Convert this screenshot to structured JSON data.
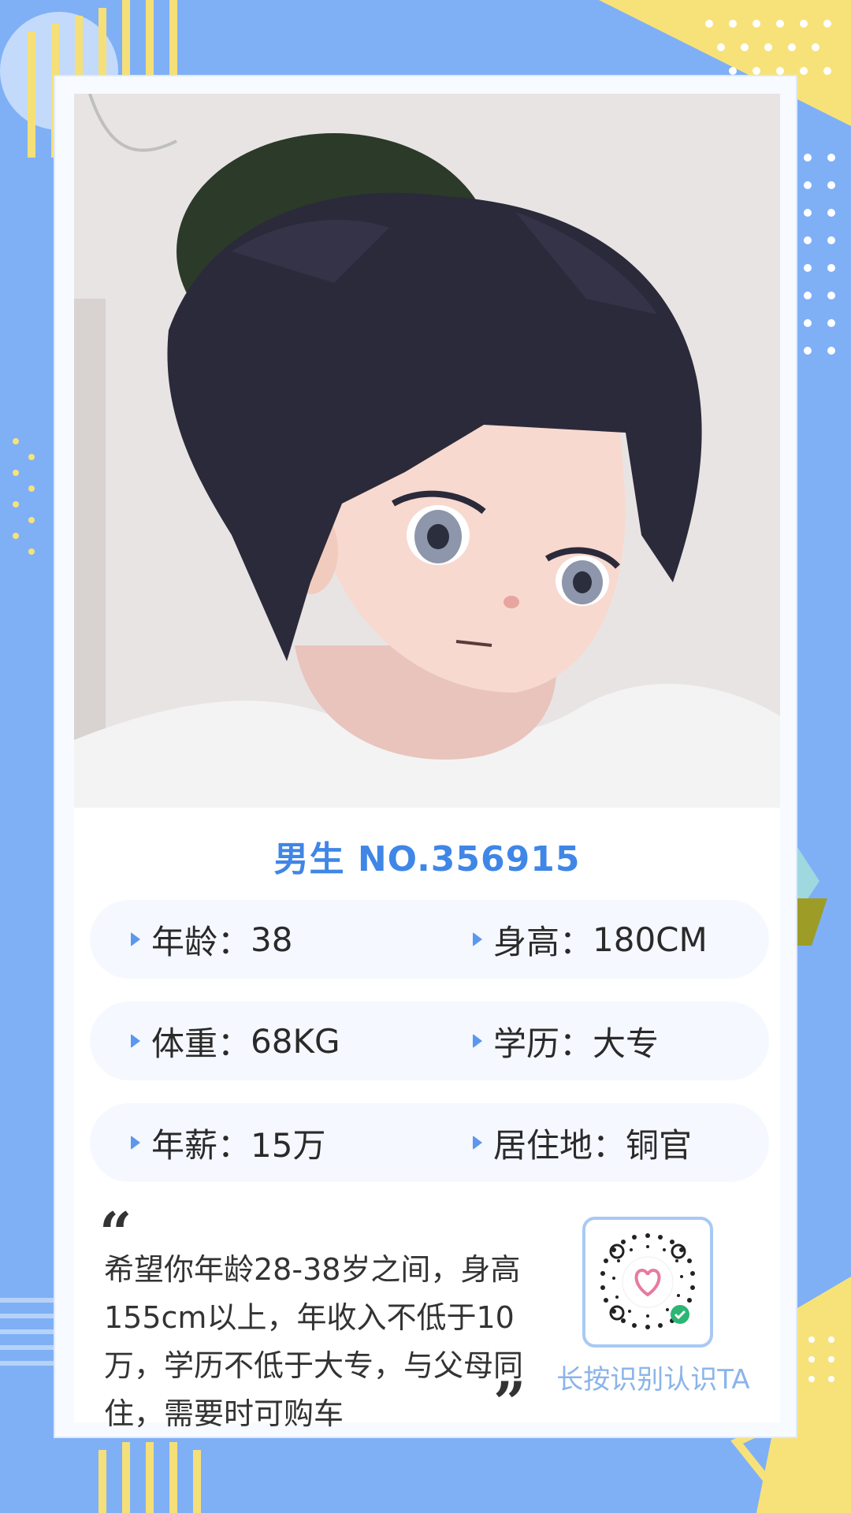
{
  "profile": {
    "title": "男生 NO.356915",
    "rows": [
      [
        {
          "label": "年龄：",
          "value": "38"
        },
        {
          "label": "身高：",
          "value": "180CM"
        }
      ],
      [
        {
          "label": "体重：",
          "value": "68KG"
        },
        {
          "label": "学历：",
          "value": "大专"
        }
      ],
      [
        {
          "label": "年薪：",
          "value": "15万"
        },
        {
          "label": "居住地：",
          "value": "铜官"
        }
      ]
    ],
    "wish_text": "希望你年龄28-38岁之间，身高155cm以上，年收入不低于10万，学历不低于大专，与父母同住，需要时可购车",
    "quote_open": "“",
    "quote_close": "”",
    "qr_label": "长按识别认识TA",
    "photo_icon": "anime-avatar-portrait",
    "qr_icon": "mini-program-code-icon"
  },
  "colors": {
    "background": "#7fb0f6",
    "accent_blue": "#3f86e6",
    "accent_yellow": "#f7e27a",
    "qr_label": "#8bb4ea"
  }
}
